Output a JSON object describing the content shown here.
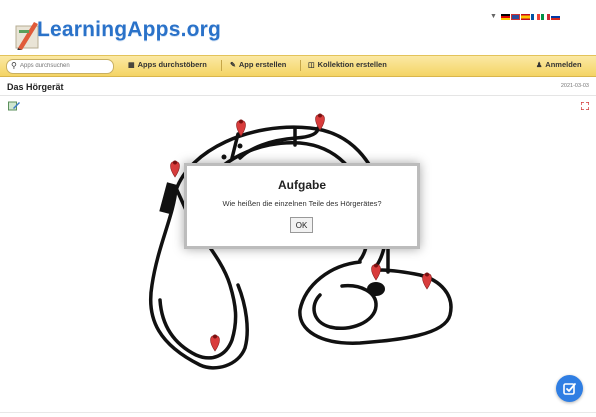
{
  "header": {
    "logo_text": "LearningApps.org",
    "language_flags": [
      "de-flag-icon",
      "en-flag-icon",
      "es-flag-icon",
      "fr-flag-icon",
      "it-flag-icon",
      "other-flag-icon"
    ]
  },
  "toolbar": {
    "search_placeholder": "Apps durchsuchen",
    "browse_label": "Apps durchstöbern",
    "create_label": "App erstellen",
    "collection_label": "Kollektion erstellen",
    "login_label": "Anmelden"
  },
  "page": {
    "title": "Das Hörgerät",
    "date": "2021-03-03"
  },
  "dialog": {
    "title": "Aufgabe",
    "text": "Wie heißen die einzelnen Teile des Hörgerätes?",
    "ok_label": "OK"
  },
  "colors": {
    "brand_blue": "#2a72c9",
    "toolbar_yellow": "#f4d465",
    "pin_red": "#d93c3c",
    "fab_blue": "#2f7ee3"
  }
}
